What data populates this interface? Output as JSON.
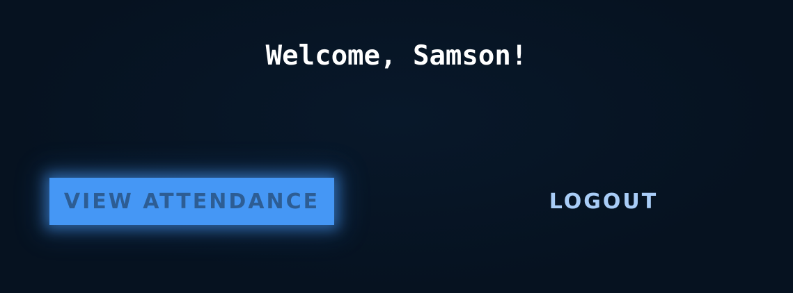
{
  "header": {
    "welcome_text": "Welcome, Samson!"
  },
  "actions": {
    "view_attendance_label": "VIEW ATTENDANCE",
    "logout_label": "LOGOUT"
  },
  "colors": {
    "background": "#061220",
    "primary_button": "#4597f5",
    "primary_button_text": "#2d5d94",
    "secondary_text": "#a9cdf7",
    "heading_text": "#ffffff"
  }
}
